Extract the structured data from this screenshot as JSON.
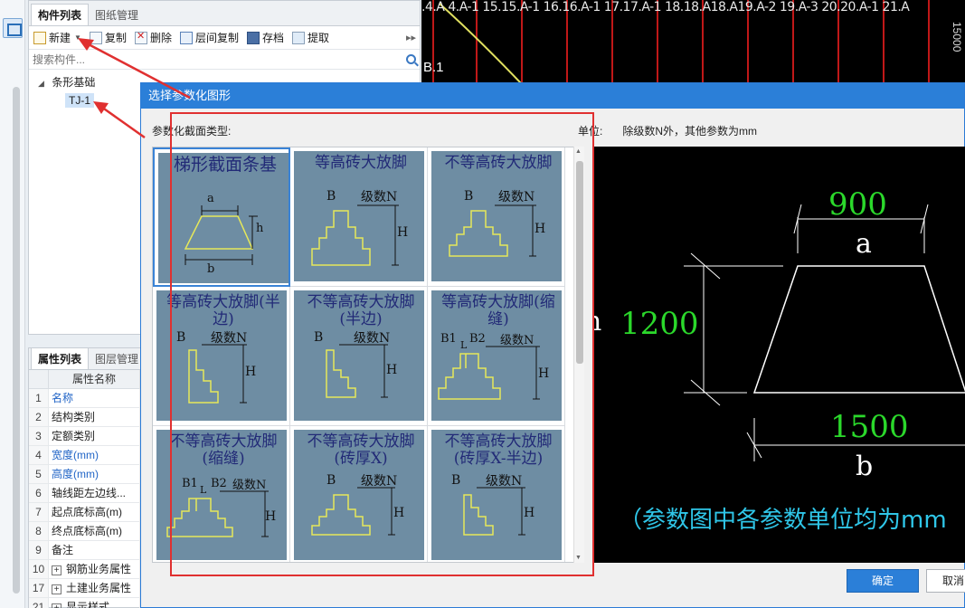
{
  "component_panel": {
    "tabs": [
      "构件列表",
      "图纸管理"
    ],
    "toolbar": {
      "new_label": "新建",
      "copy_label": "复制",
      "delete_label": "删除",
      "floor_copy_label": "层间复制",
      "save_label": "存档",
      "extract_label": "提取"
    },
    "search_placeholder": "搜索构件...",
    "tree": {
      "root_label": "条形基础",
      "child_label": "TJ-1"
    }
  },
  "property_panel": {
    "tabs": [
      "属性列表",
      "图层管理"
    ],
    "header_name": "属性名称",
    "rows": [
      {
        "num": "1",
        "name": "名称",
        "highlight": true
      },
      {
        "num": "2",
        "name": "结构类别",
        "highlight": false
      },
      {
        "num": "3",
        "name": "定额类别",
        "highlight": false
      },
      {
        "num": "4",
        "name": "宽度(mm)",
        "highlight": true
      },
      {
        "num": "5",
        "name": "高度(mm)",
        "highlight": true
      },
      {
        "num": "6",
        "name": "轴线距左边线...",
        "highlight": false
      },
      {
        "num": "7",
        "name": "起点底标高(m)",
        "highlight": false
      },
      {
        "num": "8",
        "name": "终点底标高(m)",
        "highlight": false
      },
      {
        "num": "9",
        "name": "备注",
        "highlight": false
      },
      {
        "num": "10",
        "name": "钢筋业务属性",
        "highlight": false,
        "expand": true
      },
      {
        "num": "17",
        "name": "土建业务属性",
        "highlight": false,
        "expand": true
      },
      {
        "num": "21",
        "name": "显示样式",
        "highlight": false,
        "expand": true
      }
    ]
  },
  "cad": {
    "axis_labels": ".4.A 4.A-1 15.15.A-1 16.16.A-1 17.17.A-1 18.18.A18.A19.A-2 19.A-3 20.20.A-1 21.A",
    "b1_label": "B.1",
    "right_label": "15000"
  },
  "dialog": {
    "title": "选择参数化图形",
    "type_label": "参数化截面类型:",
    "unit_label": "单位:",
    "unit_desc": "除级数N外，其他参数为mm",
    "shapes": [
      {
        "title": "梯形截面条基",
        "a": "a",
        "b": "b",
        "h": "h"
      },
      {
        "title": "等高砖大放脚",
        "B": "B",
        "N": "级数N",
        "H": "H"
      },
      {
        "title": "不等高砖大放脚",
        "B": "B",
        "N": "级数N",
        "H": "H"
      },
      {
        "title": "等高砖大放脚(半边)",
        "B": "B",
        "N": "级数N",
        "H": "H"
      },
      {
        "title": "不等高砖大放脚(半边)",
        "B": "B",
        "N": "级数N",
        "H": "H"
      },
      {
        "title": "等高砖大放脚(缩缝)",
        "B1": "B1",
        "B2": "B2",
        "L": "L",
        "N": "级数N",
        "H": "H"
      },
      {
        "title": "不等高砖大放脚(缩缝)",
        "B1": "B1",
        "B2": "B2",
        "L": "L",
        "N": "级数N",
        "H": "H"
      },
      {
        "title": "不等高砖大放脚(砖厚X)",
        "B": "B",
        "N": "级数N",
        "H": "H"
      },
      {
        "title": "不等高砖大放脚(砖厚X-半边)",
        "B": "B",
        "N": "级数N",
        "H": "H"
      }
    ],
    "preview": {
      "a_value": "900",
      "a_label": "a",
      "h_value": "1200",
      "h_label": "h",
      "b_value": "1500",
      "b_label": "b",
      "note": "（参数图中各参数单位均为mm"
    },
    "ok_label": "确定",
    "cancel_label": "取消"
  },
  "colors": {
    "accent": "#2b7fd8",
    "thumb_bg": "#6e8da3",
    "shape_yellow": "#e6e85a",
    "dim_green": "#2bd82b",
    "note_cyan": "#2fc6e8",
    "annotation_red": "#e03030"
  }
}
